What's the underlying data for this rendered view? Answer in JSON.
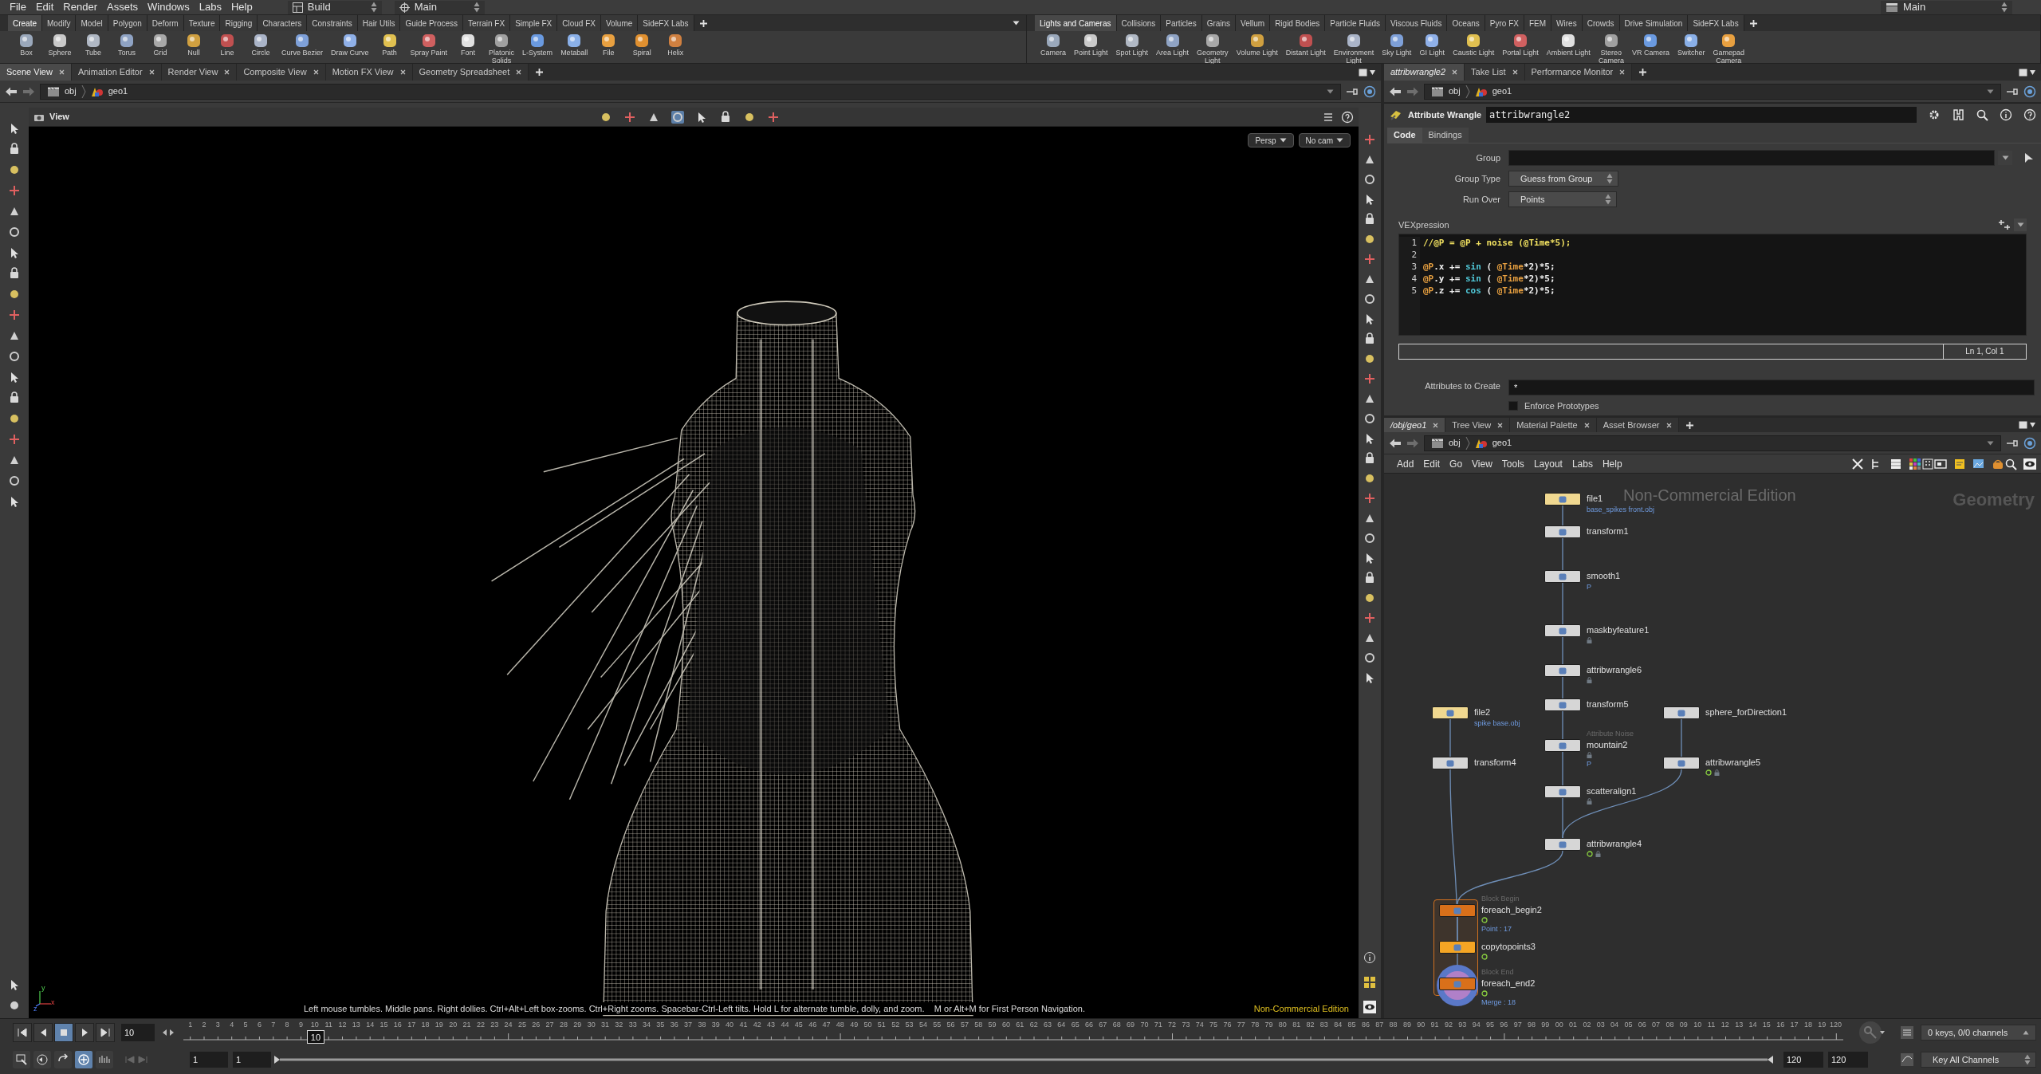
{
  "menubar": {
    "menus": [
      "File",
      "Edit",
      "Render",
      "Assets",
      "Windows",
      "Labs",
      "Help"
    ],
    "desktop": "Build",
    "context": "Main",
    "right_context": "Main"
  },
  "shelf_left": {
    "tabs": [
      {
        "label": "Create",
        "selected": true
      },
      {
        "label": "Modify",
        "selected": false
      },
      {
        "label": "Model",
        "selected": false
      },
      {
        "label": "Polygon",
        "selected": false
      },
      {
        "label": "Deform",
        "selected": false
      },
      {
        "label": "Texture",
        "selected": false
      },
      {
        "label": "Rigging",
        "selected": false
      },
      {
        "label": "Characters",
        "selected": false
      },
      {
        "label": "Constraints",
        "selected": false
      },
      {
        "label": "Hair Utils",
        "selected": false
      },
      {
        "label": "Guide Process",
        "selected": false
      },
      {
        "label": "Terrain FX",
        "selected": false
      },
      {
        "label": "Simple FX",
        "selected": false
      },
      {
        "label": "Cloud FX",
        "selected": false
      },
      {
        "label": "Volume",
        "selected": false
      },
      {
        "label": "SideFX Labs",
        "selected": false
      }
    ],
    "tools": [
      {
        "label": "Box"
      },
      {
        "label": "Sphere"
      },
      {
        "label": "Tube"
      },
      {
        "label": "Torus"
      },
      {
        "label": "Grid"
      },
      {
        "label": "Null"
      },
      {
        "label": "Line"
      },
      {
        "label": "Circle"
      },
      {
        "label": "Curve Bezier"
      },
      {
        "label": "Draw Curve"
      },
      {
        "label": "Path"
      },
      {
        "label": "Spray Paint"
      },
      {
        "label": "Font"
      },
      {
        "label": "Platonic\nSolids"
      },
      {
        "label": "L-System"
      },
      {
        "label": "Metaball"
      },
      {
        "label": "File"
      },
      {
        "label": "Spiral"
      },
      {
        "label": "Helix"
      }
    ]
  },
  "shelf_right": {
    "tabs": [
      {
        "label": "Lights and Cameras",
        "selected": true
      },
      {
        "label": "Collisions",
        "selected": false
      },
      {
        "label": "Particles",
        "selected": false
      },
      {
        "label": "Grains",
        "selected": false
      },
      {
        "label": "Vellum",
        "selected": false
      },
      {
        "label": "Rigid Bodies",
        "selected": false
      },
      {
        "label": "Particle Fluids",
        "selected": false
      },
      {
        "label": "Viscous Fluids",
        "selected": false
      },
      {
        "label": "Oceans",
        "selected": false
      },
      {
        "label": "Pyro FX",
        "selected": false
      },
      {
        "label": "FEM",
        "selected": false
      },
      {
        "label": "Wires",
        "selected": false
      },
      {
        "label": "Crowds",
        "selected": false
      },
      {
        "label": "Drive Simulation",
        "selected": false
      },
      {
        "label": "SideFX Labs",
        "selected": false
      }
    ],
    "tools": [
      {
        "label": "Camera"
      },
      {
        "label": "Point Light"
      },
      {
        "label": "Spot Light"
      },
      {
        "label": "Area Light"
      },
      {
        "label": "Geometry\nLight"
      },
      {
        "label": "Volume Light"
      },
      {
        "label": "Distant Light"
      },
      {
        "label": "Environment\nLight"
      },
      {
        "label": "Sky Light"
      },
      {
        "label": "GI Light"
      },
      {
        "label": "Caustic Light"
      },
      {
        "label": "Portal Light"
      },
      {
        "label": "Ambient Light"
      },
      {
        "label": "Stereo\nCamera"
      },
      {
        "label": "VR Camera"
      },
      {
        "label": "Switcher"
      },
      {
        "label": "Gamepad\nCamera"
      }
    ]
  },
  "scene_pane": {
    "tabs": [
      {
        "label": "Scene View",
        "selected": true
      },
      {
        "label": "Animation Editor",
        "selected": false
      },
      {
        "label": "Render View",
        "selected": false
      },
      {
        "label": "Composite View",
        "selected": false
      },
      {
        "label": "Motion FX View",
        "selected": false
      },
      {
        "label": "Geometry Spreadsheet",
        "selected": false
      }
    ],
    "path": [
      "obj",
      "geo1"
    ],
    "viewport": {
      "title": "View",
      "view_tools": [
        {
          "selected": false
        },
        {
          "selected": false
        },
        {
          "selected": false
        },
        {
          "selected": true
        },
        {
          "selected": false
        },
        {
          "selected": false
        },
        {
          "selected": false
        },
        {
          "selected": false
        }
      ],
      "camera": "Persp",
      "cam_menu": "No cam",
      "axes": [
        "y",
        "x",
        "z"
      ],
      "hint": "Left mouse tumbles. Middle pans. Right dollies. Ctrl+Alt+Left box-zooms. Ctrl+Right zooms. Spacebar-Ctrl-Left tilts. Hold L for alternate tumble, dolly, and zoom.    M or Alt+M for First Person Navigation.",
      "edition": "Non-Commercial Edition"
    }
  },
  "parameter_pane": {
    "tabs": [
      {
        "label": "attribwrangle2",
        "selected": true
      },
      {
        "label": "Take List",
        "selected": false
      },
      {
        "label": "Performance Monitor",
        "selected": false
      }
    ],
    "path": [
      "obj",
      "geo1"
    ],
    "node_type": "Attribute Wrangle",
    "node_name": "attribwrangle2",
    "param_tabs": [
      {
        "label": "Code",
        "selected": true
      },
      {
        "label": "Bindings",
        "selected": false
      }
    ],
    "group": {
      "label": "Group"
    },
    "group_type": {
      "label": "Group Type",
      "value": "Guess from Group"
    },
    "run_over": {
      "label": "Run Over",
      "value": "Points"
    },
    "vex": {
      "label": "VEXpression",
      "lines": [
        {
          "number": "1",
          "tokens": [
            {
              "text": "//@P = @P + noise (@Time*5);",
              "kind": "comment"
            }
          ]
        },
        {
          "number": "2"
        },
        {
          "number": "3",
          "tokens": [
            {
              "text": "@P",
              "kind": "attr"
            },
            {
              "text": ".x += ",
              "kind": "plain"
            },
            {
              "text": "sin",
              "kind": "func"
            },
            {
              "text": " ( ",
              "kind": "plain"
            },
            {
              "text": "@Time",
              "kind": "attr"
            },
            {
              "text": "*2)*5;",
              "kind": "plain"
            }
          ]
        },
        {
          "number": "4",
          "tokens": [
            {
              "text": "@P",
              "kind": "attr"
            },
            {
              "text": ".y += ",
              "kind": "plain"
            },
            {
              "text": "sin",
              "kind": "func"
            },
            {
              "text": " ( ",
              "kind": "plain"
            },
            {
              "text": "@Time",
              "kind": "attr"
            },
            {
              "text": "*2)*5;",
              "kind": "plain"
            }
          ]
        },
        {
          "number": "5",
          "tokens": [
            {
              "text": "@P",
              "kind": "attr"
            },
            {
              "text": ".z += ",
              "kind": "plain"
            },
            {
              "text": "cos",
              "kind": "func"
            },
            {
              "text": " ( ",
              "kind": "plain"
            },
            {
              "text": "@Time",
              "kind": "attr"
            },
            {
              "text": "*2)*5;",
              "kind": "plain"
            }
          ]
        }
      ],
      "status": "Ln 1, Col 1"
    },
    "attributes_to_create": {
      "label": "Attributes to Create",
      "value": "*"
    },
    "enforce_prototypes": {
      "label": "Enforce Prototypes",
      "checked": false
    }
  },
  "network_pane": {
    "tabs": [
      {
        "label": "/obj/geo1",
        "selected": true
      },
      {
        "label": "Tree View",
        "selected": false
      },
      {
        "label": "Material Palette",
        "selected": false
      },
      {
        "label": "Asset Browser",
        "selected": false
      }
    ],
    "path": [
      "obj",
      "geo1"
    ],
    "menus": [
      "Add",
      "Edit",
      "Go",
      "View",
      "Tools",
      "Layout",
      "Labs",
      "Help"
    ],
    "watermark": "Non-Commercial Edition",
    "context_label": "Geometry",
    "nodes": [
      {
        "name": "file1",
        "color": "#f0d890",
        "sublabel": "base_spikes front.obj"
      },
      {
        "name": "transform1",
        "color": "#d6d6d6"
      },
      {
        "name": "smooth1",
        "color": "#d6d6d6",
        "sublabel": "P"
      },
      {
        "name": "maskbyfeature1",
        "color": "#d6d6d6",
        "locked": true
      },
      {
        "name": "attribwrangle6",
        "color": "#d6d6d6",
        "locked": true
      },
      {
        "name": "transform5",
        "color": "#d6d6d6"
      },
      {
        "name": "mountain2",
        "color": "#d6d6d6",
        "above": "Attribute Noise",
        "locked": true,
        "sublabel": "P"
      },
      {
        "name": "scatteralign1",
        "color": "#d6d6d6",
        "locked": true
      },
      {
        "name": "attribwrangle4",
        "color": "#d6d6d6",
        "output_flag": true,
        "locked": true
      },
      {
        "name": "file2",
        "color": "#f0d890",
        "sublabel": "spike base.obj"
      },
      {
        "name": "transform4",
        "color": "#d6d6d6"
      },
      {
        "name": "sphere_forDirection1",
        "color": "#d6d6d6"
      },
      {
        "name": "attribwrangle5",
        "color": "#d6d6d6",
        "output_flag": true,
        "locked": true
      },
      {
        "name": "foreach_begin2",
        "color": "#d9701a",
        "above": "Block Begin",
        "output_flag": true,
        "sublabel": "Point : 17"
      },
      {
        "name": "copytopoints3",
        "color": "#f5a524",
        "output_flag": true
      },
      {
        "name": "foreach_end2",
        "color": "#d9701a",
        "above": "Block End",
        "display_flag": true,
        "output_flag": true,
        "sublabel": "Merge : 18"
      }
    ]
  },
  "timeline": {
    "transport": [
      {
        "kind": "first",
        "selected": false
      },
      {
        "kind": "prev",
        "selected": false
      },
      {
        "kind": "stop",
        "selected": true
      },
      {
        "kind": "play",
        "selected": false
      },
      {
        "kind": "last",
        "selected": false
      }
    ],
    "current_frame": "10",
    "marker": "10",
    "ticks": [
      "1",
      "2",
      "3",
      "4",
      "5",
      "6",
      "7",
      "8",
      "9",
      "10",
      "11",
      "12",
      "13",
      "14",
      "15",
      "16",
      "17",
      "18",
      "19",
      "20",
      "21",
      "22",
      "23",
      "24",
      "25",
      "26",
      "27",
      "28",
      "29",
      "30",
      "31",
      "32",
      "33",
      "34",
      "35",
      "36",
      "37",
      "38",
      "39",
      "40",
      "41",
      "42",
      "43",
      "44",
      "45",
      "46",
      "47",
      "48",
      "49",
      "50",
      "51",
      "52",
      "53",
      "54",
      "55",
      "56",
      "57",
      "58",
      "59",
      "60",
      "61",
      "62",
      "63",
      "64",
      "65",
      "66",
      "67",
      "68",
      "69",
      "70",
      "71",
      "72",
      "73",
      "74",
      "75",
      "76",
      "77",
      "78",
      "79",
      "80",
      "81",
      "82",
      "83",
      "84",
      "85",
      "86",
      "87",
      "88",
      "89",
      "90",
      "91",
      "92",
      "93",
      "94",
      "95",
      "96",
      "97",
      "98",
      "99",
      "00",
      "01",
      "02",
      "03",
      "04",
      "05",
      "06",
      "07",
      "08",
      "09",
      "10",
      "11",
      "12",
      "13",
      "14",
      "15",
      "16",
      "17",
      "18",
      "19",
      "120"
    ],
    "bottom_tools": [
      {
        "selected": false
      },
      {
        "selected": false
      },
      {
        "selected": false
      },
      {
        "selected": true
      },
      {
        "selected": false
      }
    ],
    "start": "1",
    "range_start": "1",
    "range_end": "120",
    "end": "120",
    "keys_status": "0 keys, 0/0 channels",
    "key_mode": "Key All Channels"
  }
}
